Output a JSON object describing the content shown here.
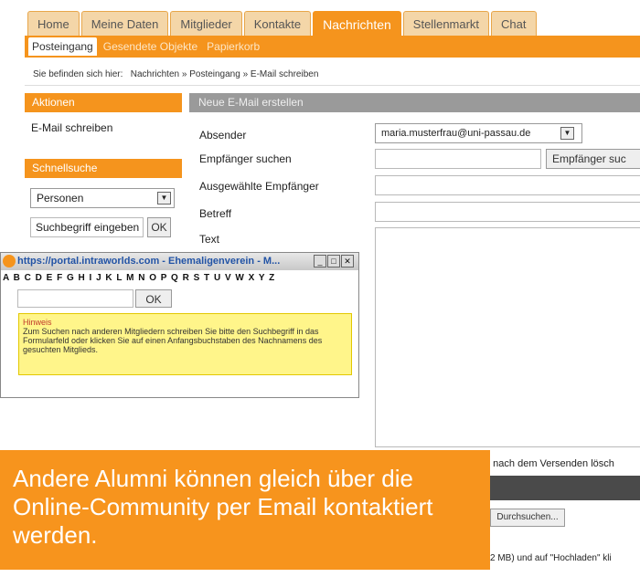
{
  "tabs": [
    "Home",
    "Meine Daten",
    "Mitglieder",
    "Kontakte",
    "Nachrichten",
    "Stellenmarkt",
    "Chat"
  ],
  "active_tab": "Nachrichten",
  "subtabs": [
    "Posteingang",
    "Gesendete Objekte",
    "Papierkorb"
  ],
  "breadcrumb": "Sie befinden sich hier:   Nachrichten » Posteingang » E-Mail schreiben",
  "left": {
    "aktionen_title": "Aktionen",
    "email_link": "E-Mail schreiben",
    "schnellsuche_title": "Schnellsuche",
    "search_type": "Personen",
    "search_placeholder": "Suchbegriff eingeben",
    "ok_label": "OK"
  },
  "form": {
    "title": "Neue E-Mail erstellen",
    "sender_label": "Absender",
    "sender_value": "maria.musterfrau@uni-passau.de",
    "recipient_search_label": "Empfänger suchen",
    "recipient_search_button": "Empfänger suc",
    "selected_recipients_label": "Ausgewählte Empfänger",
    "subject_label": "Betreff",
    "text_label": "Text",
    "delete_after_send_text": "n nach dem Versenden lösch",
    "browse_button": "Durchsuchen...",
    "upload_text": "2 MB) und auf \"Hochladen\" kli"
  },
  "popup": {
    "title": "https://portal.intraworlds.com - Ehemaligenverein - M...",
    "alphabet": "A B C D E F G H I J K L M N O P Q R S T U V W X Y Z",
    "ok_label": "OK",
    "hint_title": "Hinweis",
    "hint_text": "Zum Suchen nach anderen Mitgliedern schreiben Sie bitte den Suchbegriff in das Formularfeld oder klicken Sie auf einen Anfangsbuchstaben des Nachnamens des gesuchten Mitglieds."
  },
  "callout": "Andere Alumni können gleich über die Online-Community per Email kontaktiert werden.",
  "colors": {
    "accent": "#f5941d",
    "header_gray": "#9a9a9a",
    "hint_yellow": "#fff58a"
  }
}
